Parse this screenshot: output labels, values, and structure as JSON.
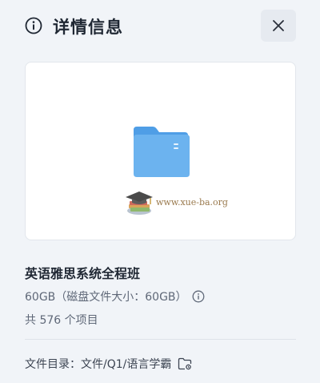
{
  "header": {
    "info_icon": "info-circle-icon",
    "title": "详情信息",
    "close_icon": "close-icon"
  },
  "preview": {
    "folder_icon": "folder-icon",
    "watermark_icon": "graduation-cap-books-icon",
    "watermark_text": "www.xue-ba.org"
  },
  "details": {
    "name": "英语雅思系统全程班",
    "size": "60GB（磁盘文件大小：60GB）",
    "size_help_icon": "info-circle-icon",
    "count": "共 576 个项目"
  },
  "path": {
    "label": "文件目录：",
    "value": "文件/Q1/语言学霸",
    "folder_icon": "folder-link-icon"
  },
  "colors": {
    "background": "#f1f4f8",
    "folder_blue": "#6cb3ef",
    "folder_tab": "#4f9ee6",
    "text_primary": "#1f2733",
    "text_secondary": "#5f6878"
  }
}
